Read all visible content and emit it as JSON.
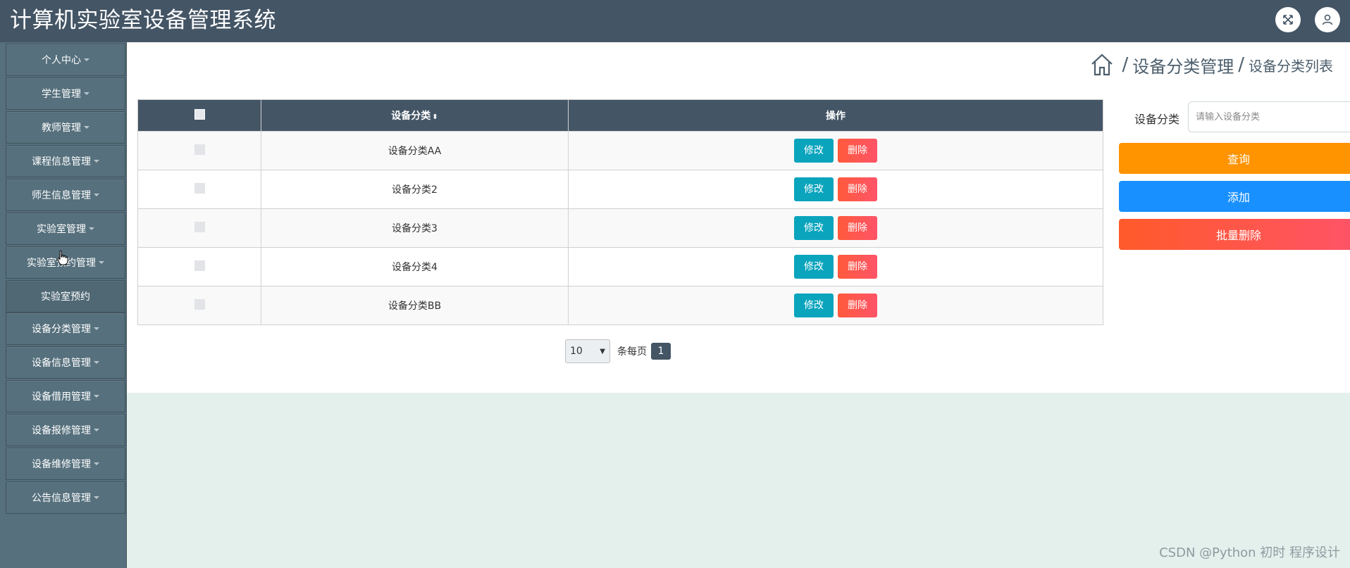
{
  "header": {
    "title": "计算机实验室设备管理系统",
    "fullscreen_icon": "expand-icon",
    "user_icon": "user-icon"
  },
  "sidebar": {
    "items": [
      {
        "label": "个人中心",
        "caret": true
      },
      {
        "label": "学生管理",
        "caret": true
      },
      {
        "label": "教师管理",
        "caret": true
      },
      {
        "label": "课程信息管理",
        "caret": true
      },
      {
        "label": "师生信息管理",
        "caret": true
      },
      {
        "label": "实验室管理",
        "caret": true
      },
      {
        "label": "实验室预约管理",
        "caret": true
      },
      {
        "label": "实验室预约",
        "caret": false
      },
      {
        "label": "设备分类管理",
        "caret": true
      },
      {
        "label": "设备信息管理",
        "caret": true
      },
      {
        "label": "设备借用管理",
        "caret": true
      },
      {
        "label": "设备报修管理",
        "caret": true
      },
      {
        "label": "设备维修管理",
        "caret": true
      },
      {
        "label": "公告信息管理",
        "caret": true
      }
    ]
  },
  "breadcrumb": {
    "sep": "/",
    "section": "设备分类管理",
    "current": "设备分类列表"
  },
  "table": {
    "headers": {
      "name": "设备分类",
      "name_sort": "⬍",
      "actions": "操作"
    },
    "rows": [
      {
        "name": "设备分类AA"
      },
      {
        "name": "设备分类2"
      },
      {
        "name": "设备分类3"
      },
      {
        "name": "设备分类4"
      },
      {
        "name": "设备分类BB"
      }
    ],
    "edit_label": "修改",
    "delete_label": "删除"
  },
  "pagination": {
    "page_size": "10",
    "per_page_label": "条每页",
    "current_page": "1"
  },
  "search": {
    "label": "设备分类",
    "placeholder": "请输入设备分类",
    "query_label": "查询",
    "add_label": "添加",
    "batch_delete_label": "批量删除"
  },
  "watermark": "CSDN @Python 初时 程序设计",
  "colors": {
    "header_bg": "#445565",
    "sidebar_bg": "#56707d",
    "edit": "#0aa4bd",
    "delete": "#ff5a3c",
    "query": "#ff9300",
    "add": "#1890ff"
  }
}
